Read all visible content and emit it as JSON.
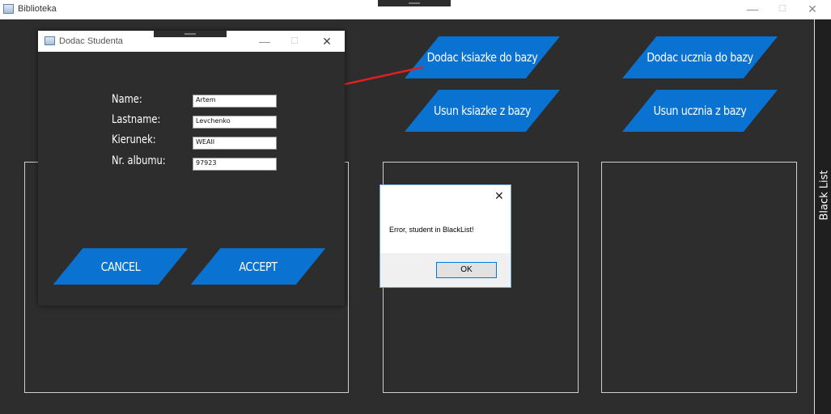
{
  "window": {
    "title": "Biblioteka",
    "minimize": "—",
    "maximize": "☐",
    "close": "✕"
  },
  "buttons": {
    "add_book": "Dodac ksiazke do bazy",
    "add_student": "Dodac ucznia do bazy",
    "remove_book": "Usun ksiazke z bazy",
    "remove_student": "Usun ucznia z bazy"
  },
  "sidebar": {
    "label": "Black List"
  },
  "dialog": {
    "title": "Dodac Studenta",
    "minimize": "—",
    "maximize": "☐",
    "close": "✕",
    "fields": {
      "name_label": "Name:",
      "name_value": "Artem",
      "lastname_label": "Lastname:",
      "lastname_value": "Levchenko",
      "kierunek_label": "Kierunek:",
      "kierunek_value": "WEAII",
      "album_label": "Nr. albumu:",
      "album_value": "97923"
    },
    "cancel": "CANCEL",
    "accept": "ACCEPT"
  },
  "message_box": {
    "close": "✕",
    "text": "Error, student in BlackList!",
    "ok": "OK"
  },
  "colors": {
    "accent": "#0a73d1",
    "background": "#2d2d2d",
    "arrow": "#e02020"
  }
}
